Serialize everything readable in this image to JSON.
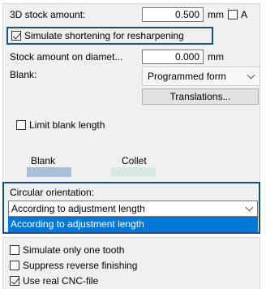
{
  "stock": {
    "label_3d": "3D stock amount:",
    "value_3d": "0.500",
    "unit_3d": "mm",
    "checkbox_a_label": "A",
    "simulate_shortening_label": "Simulate shortening for resharpening",
    "label_diameter": "Stock amount on diamet...",
    "value_diameter": "0.000",
    "unit_diameter": "mm"
  },
  "blank": {
    "label": "Blank:",
    "selected": "Programmed form",
    "translations_button": "Translations...",
    "limit_length_label": "Limit blank length"
  },
  "legend": {
    "blank_label": "Blank",
    "collet_label": "Collet",
    "blank_color": "#a9bfd8",
    "collet_color": "#d8e7e1"
  },
  "circular_orientation": {
    "label": "Circular orientation:",
    "selected": "According to adjustment length",
    "dropdown_options": [
      "According to adjustment length"
    ]
  },
  "options": {
    "simulate_one_tooth_label": "Simulate only one tooth",
    "suppress_reverse_label": "Suppress reverse finishing",
    "use_real_cnc_label": "Use real CNC-file"
  },
  "colors": {
    "focus_border": "#1f4e79",
    "highlight": "#0078d7"
  }
}
